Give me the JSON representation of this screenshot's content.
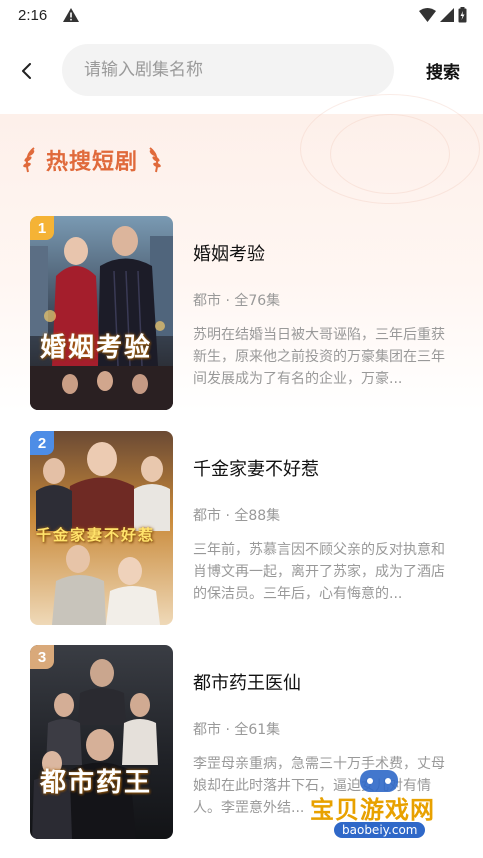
{
  "status_bar": {
    "time": "2:16"
  },
  "header": {
    "search_placeholder": "请输入剧集名称",
    "search_button": "搜索"
  },
  "section": {
    "title": "热搜短剧"
  },
  "dramas": [
    {
      "rank": "1",
      "poster_text": "婚姻考验",
      "name": "婚姻考验",
      "meta": "都市 · 全76集",
      "description": "苏明在结婚当日被大哥诬陷，三年后重获新生，原来他之前投资的万豪集团在三年间发展成为了有名的企业，万豪..."
    },
    {
      "rank": "2",
      "poster_text": "千金家妻不好惹",
      "name": "千金家妻不好惹",
      "meta": "都市 · 全88集",
      "description": "三年前，苏慕言因不顾父亲的反对执意和肖博文再一起，离开了苏家，成为了酒店的保洁员。三年后，心有悔意的..."
    },
    {
      "rank": "3",
      "poster_text": "都市药王",
      "name": "都市药王医仙",
      "meta": "都市 · 全61集",
      "description": "李罡母亲重病，急需三十万手术费，丈母娘却在此时落井下石，逼迫女儿对有情人。李罡意外结..."
    }
  ],
  "watermark": {
    "text": "宝贝游戏网",
    "url": "baobeiy.com"
  },
  "colors": {
    "accent": "#e06a3b",
    "badge_1": "#f5b335",
    "badge_2": "#4d8de6",
    "badge_3": "#d9a97a"
  }
}
